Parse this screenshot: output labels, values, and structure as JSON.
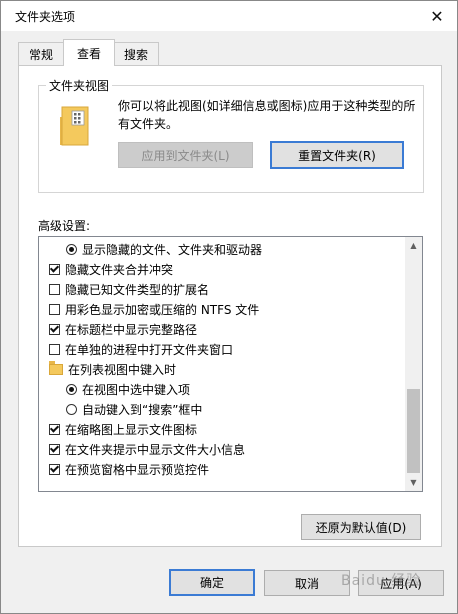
{
  "window": {
    "title": "文件夹选项"
  },
  "tabs": [
    {
      "label": "常规",
      "active": false
    },
    {
      "label": "查看",
      "active": true
    },
    {
      "label": "搜索",
      "active": false
    }
  ],
  "folder_views": {
    "legend": "文件夹视图",
    "description": "你可以将此视图(如详细信息或图标)应用于这种类型的所有文件夹。",
    "apply_button": "应用到文件夹(L)",
    "reset_button": "重置文件夹(R)"
  },
  "advanced": {
    "label": "高级设置:",
    "items": [
      {
        "type": "radio",
        "checked": true,
        "label": "显示隐藏的文件、文件夹和驱动器"
      },
      {
        "type": "checkbox",
        "checked": true,
        "label": "隐藏文件夹合并冲突"
      },
      {
        "type": "checkbox",
        "checked": false,
        "label": "隐藏已知文件类型的扩展名"
      },
      {
        "type": "checkbox",
        "checked": false,
        "label": "用彩色显示加密或压缩的 NTFS 文件"
      },
      {
        "type": "checkbox",
        "checked": true,
        "label": "在标题栏中显示完整路径"
      },
      {
        "type": "checkbox",
        "checked": false,
        "label": "在单独的进程中打开文件夹窗口"
      },
      {
        "type": "folder",
        "label": "在列表视图中键入时"
      },
      {
        "type": "radio",
        "checked": true,
        "label": "在视图中选中键入项"
      },
      {
        "type": "radio",
        "checked": false,
        "label": "自动键入到“搜索”框中"
      },
      {
        "type": "checkbox",
        "checked": true,
        "label": "在缩略图上显示文件图标"
      },
      {
        "type": "checkbox",
        "checked": true,
        "label": "在文件夹提示中显示文件大小信息"
      },
      {
        "type": "checkbox",
        "checked": true,
        "label": "在预览窗格中显示预览控件"
      }
    ],
    "restore_button": "还原为默认值(D)"
  },
  "footer": {
    "ok_button": "确定",
    "cancel_button": "取消",
    "apply_button": "应用(A)"
  },
  "watermark": "Baidu 经验",
  "colors": {
    "accent": "#3b7bd4",
    "folder": "#f4c95d"
  }
}
